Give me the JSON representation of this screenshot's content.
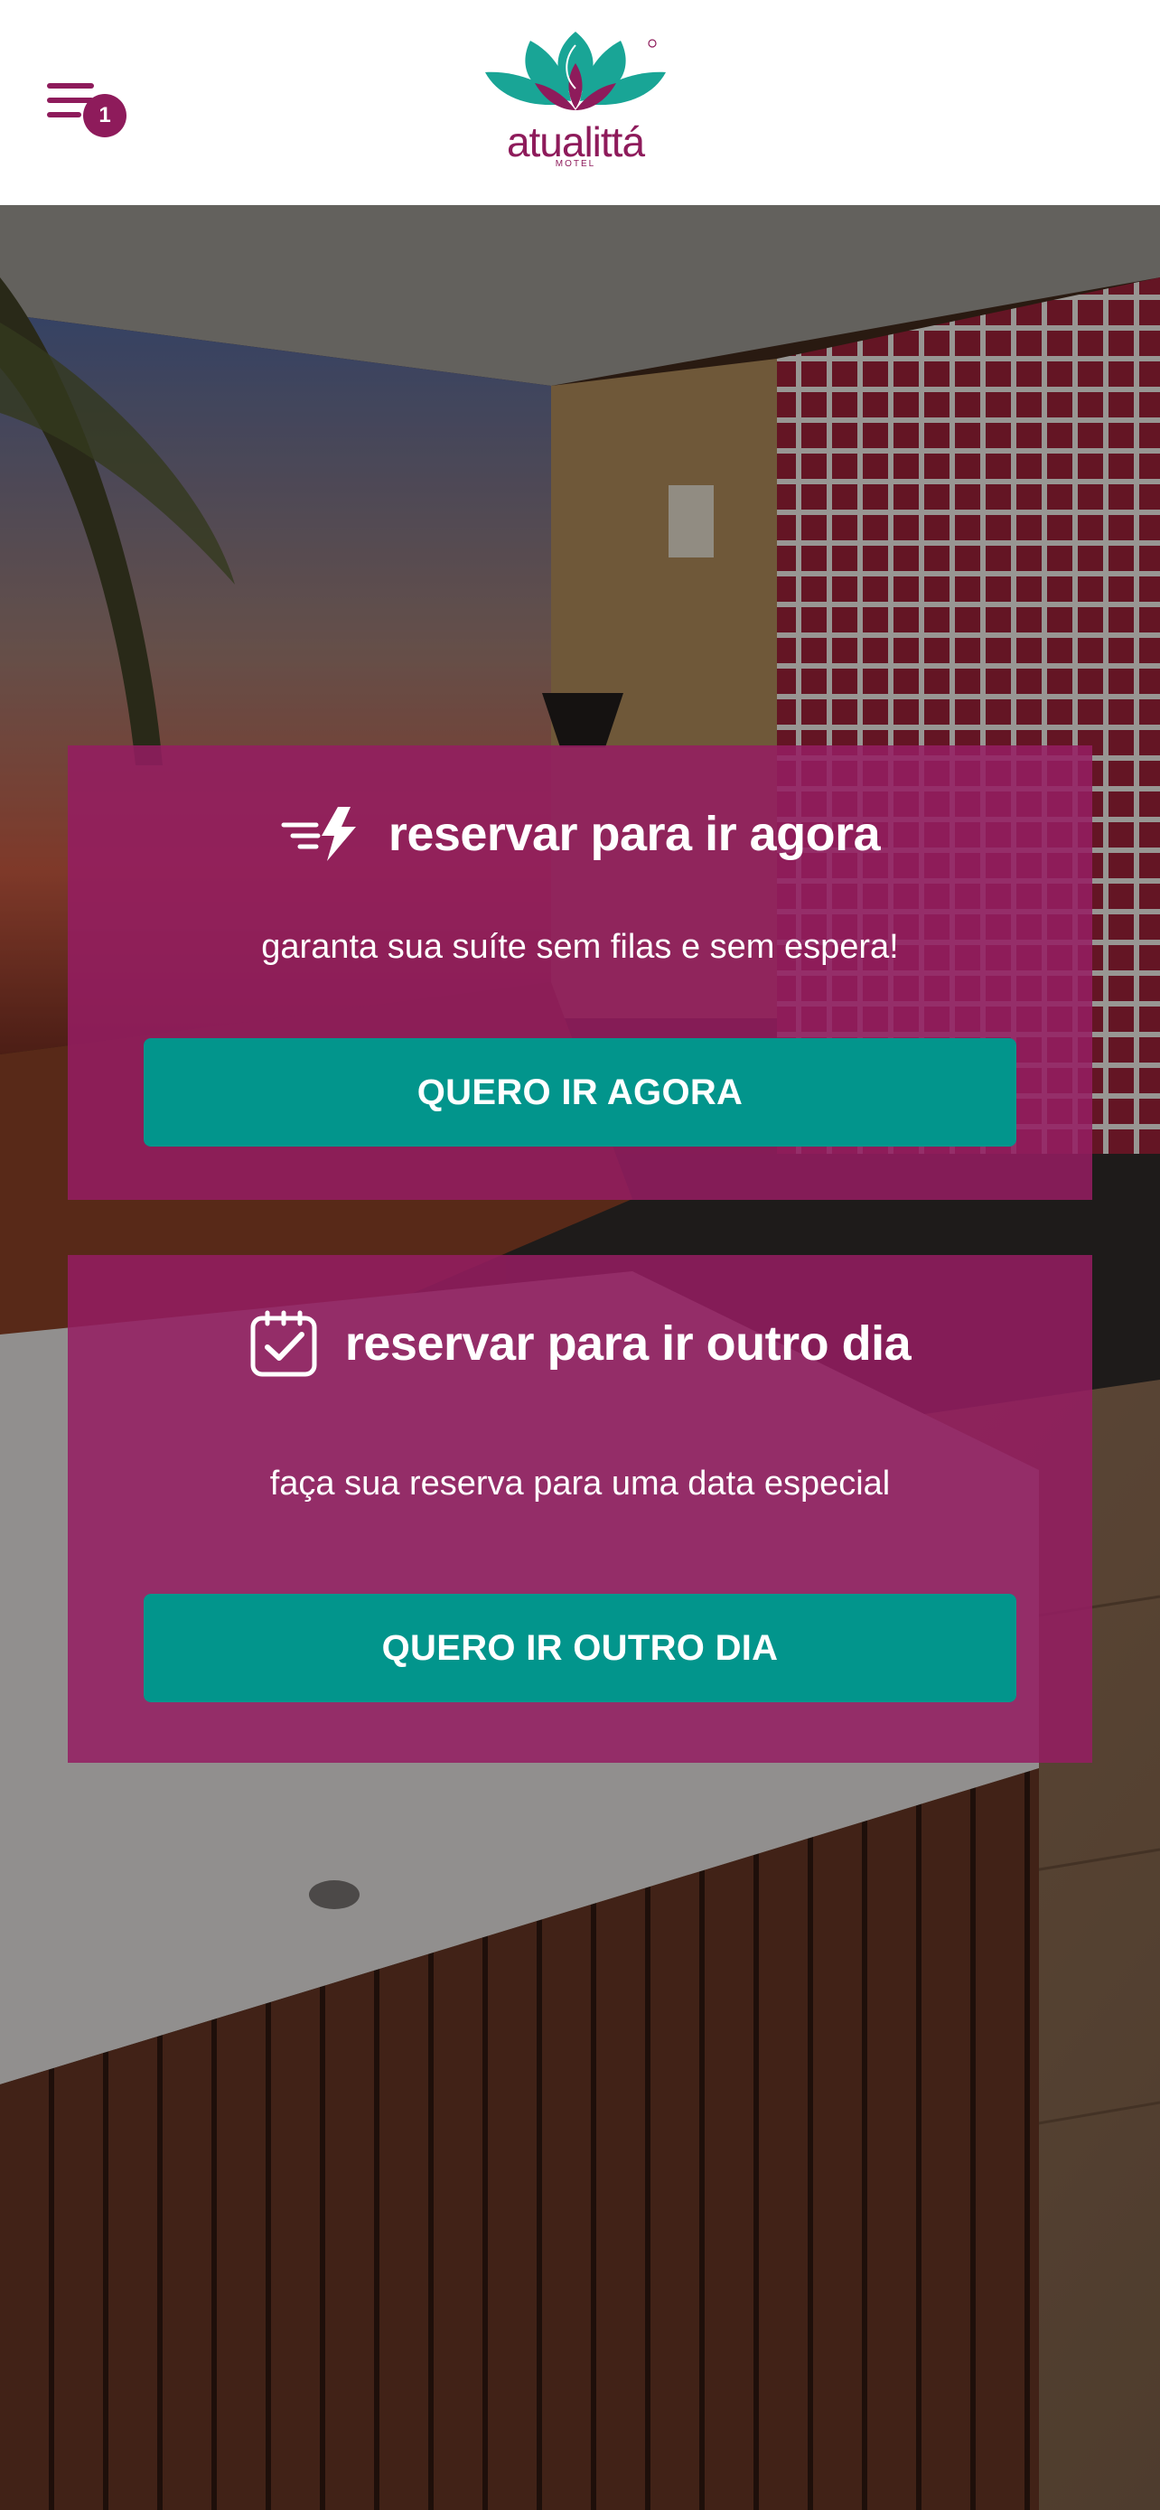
{
  "header": {
    "menu_icon": "menu-icon",
    "cart_count": "1",
    "logo": {
      "brand": "atualittá",
      "subtitle": "MOTEL"
    }
  },
  "cards": {
    "now": {
      "icon": "fast-lightning-icon",
      "title": "reservar para ir agora",
      "subtitle": "garanta sua suíte sem filas e sem espera!",
      "button": "QUERO IR AGORA"
    },
    "later": {
      "icon": "calendar-check-icon",
      "title": "reservar para ir outro dia",
      "subtitle": "faça sua reserva para uma data especial",
      "button": "QUERO IR OUTRO DIA"
    }
  },
  "colors": {
    "brand_magenta": "#8e1b5b",
    "card_bg": "#951d62",
    "button_teal": "#02958c",
    "logo_teal": "#19a596"
  }
}
